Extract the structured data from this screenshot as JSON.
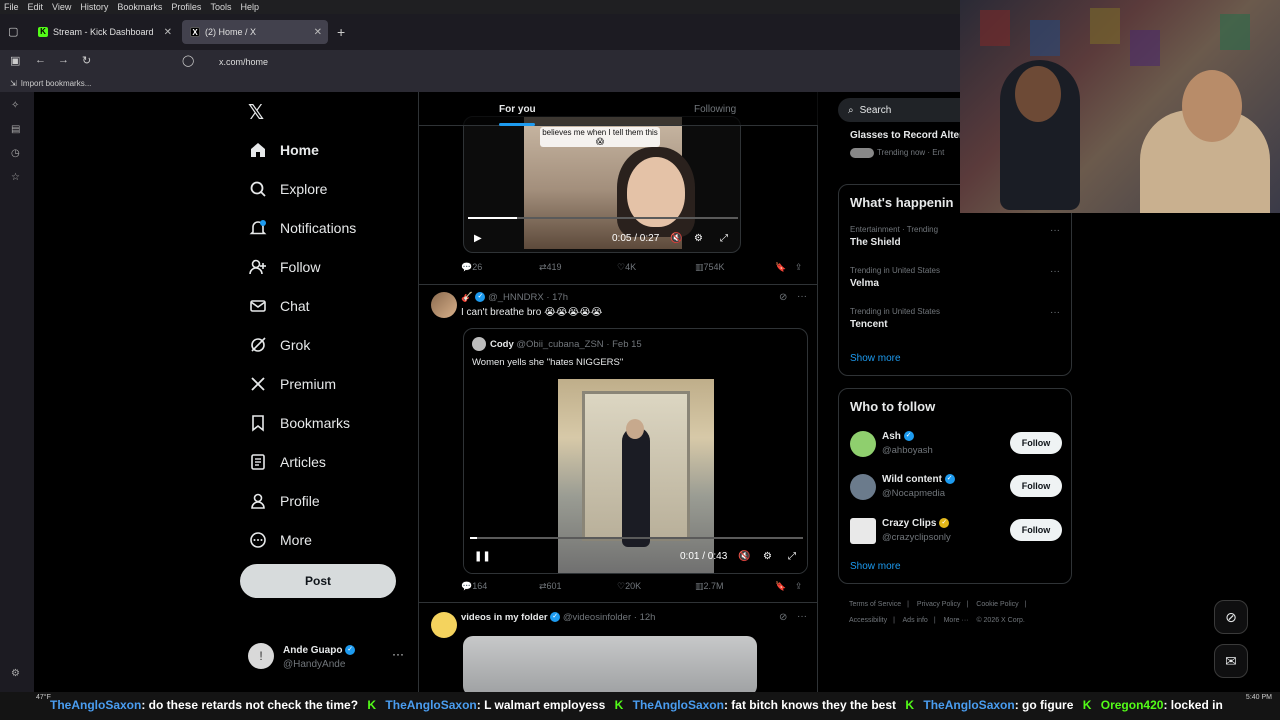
{
  "browser": {
    "menu": [
      "File",
      "Edit",
      "View",
      "History",
      "Bookmarks",
      "Profiles",
      "Tools",
      "Help"
    ],
    "tabs": [
      {
        "label": "Stream - Kick Dashboard",
        "fav": "K"
      },
      {
        "label": "(2) Home / X",
        "fav": "X"
      }
    ],
    "new_tab": "+",
    "url": "x.com/home",
    "bookmarks_label": "Import bookmarks..."
  },
  "nav": {
    "logo": "𝕏",
    "items": [
      {
        "label": "Home",
        "icon": "home-icon",
        "glyph": "⌂"
      },
      {
        "label": "Explore",
        "icon": "search-icon",
        "glyph": "⌕"
      },
      {
        "label": "Notifications",
        "icon": "bell-icon",
        "glyph": "🔔"
      },
      {
        "label": "Follow",
        "icon": "follow-icon",
        "glyph": "👤"
      },
      {
        "label": "Chat",
        "icon": "mail-icon",
        "glyph": "✉"
      },
      {
        "label": "Grok",
        "icon": "grok-icon",
        "glyph": "⊘"
      },
      {
        "label": "Premium",
        "icon": "x-icon",
        "glyph": "𝕏"
      },
      {
        "label": "Bookmarks",
        "icon": "bookmark-icon",
        "glyph": "🔖"
      },
      {
        "label": "Articles",
        "icon": "articles-icon",
        "glyph": "▤"
      },
      {
        "label": "Profile",
        "icon": "profile-icon",
        "glyph": "👤"
      },
      {
        "label": "More",
        "icon": "more-icon",
        "glyph": "⋯"
      }
    ],
    "post_label": "Post",
    "account": {
      "name": "Ande Guapo",
      "handle": "@HandyAnde",
      "more": "···"
    }
  },
  "timeline": {
    "tabs": [
      "For you",
      "Following"
    ],
    "video1": {
      "caption": "believes me when I tell them this 😱",
      "time": "0:05 / 0:27",
      "progress": 0.18,
      "actions": {
        "replies": "26",
        "reposts": "419",
        "likes": "4K",
        "views": "754K"
      }
    },
    "tweet2": {
      "handle": "@_HNNDRX",
      "time": "· 17h",
      "text": "I can't breathe bro 😭😭😭😭😭",
      "quote": {
        "name": "Cody",
        "handle": "@Obii_cubana_ZSN",
        "date": "· Feb 15",
        "text": "Women yells she \"hates NIGGERS\""
      },
      "video_time": "0:01 / 0:43",
      "progress": 0.02,
      "actions": {
        "replies": "164",
        "reposts": "601",
        "likes": "20K",
        "views": "2.7M"
      }
    },
    "tweet3": {
      "name": "videos in my folder",
      "handle": "@videosinfolder",
      "time": "· 12h"
    }
  },
  "sidebar": {
    "search_placeholder": "Search",
    "top_trend": {
      "name": "Glasses to Record Alter",
      "sub": "Trending now · Ent"
    },
    "happening_title": "What's happenin",
    "trends": [
      {
        "category": "Entertainment · Trending",
        "name": "The Shield"
      },
      {
        "category": "Trending in United States",
        "name": "Velma"
      },
      {
        "category": "Trending in United States",
        "name": "Tencent"
      }
    ],
    "show_more": "Show more",
    "who_to_follow_title": "Who to follow",
    "follow_suggestions": [
      {
        "name": "Ash",
        "handle": "@ahboyash",
        "button": "Follow",
        "badge": "blue"
      },
      {
        "name": "Wild content",
        "handle": "@Nocapmedia",
        "button": "Follow",
        "badge": "blue"
      },
      {
        "name": "Crazy Clips",
        "handle": "@crazyclipsonly",
        "button": "Follow",
        "badge": "gold"
      }
    ],
    "footer": [
      "Terms of Service",
      "|",
      "Privacy Policy",
      "|",
      "Cookie Policy",
      "|",
      "Accessibility",
      "|",
      "Ads info",
      "|",
      "More ···",
      "© 2026 X Corp."
    ]
  },
  "ticker": {
    "temp": "47°F",
    "time": "5:40 PM",
    "messages": [
      {
        "user": "TheAngloSaxon",
        "text": ": do these retards not check the time?"
      },
      {
        "user": "TheAngloSaxon",
        "text": ": L walmart employess"
      },
      {
        "user": "TheAngloSaxon",
        "text": ": fat bitch knows they the best"
      },
      {
        "user": "TheAngloSaxon",
        "text": ": go figure"
      },
      {
        "user": "Oregon420",
        "text": ": locked in"
      }
    ]
  },
  "colors": {
    "accent": "#1d9bf0",
    "kick_green": "#53fc18",
    "background": "#000000"
  }
}
